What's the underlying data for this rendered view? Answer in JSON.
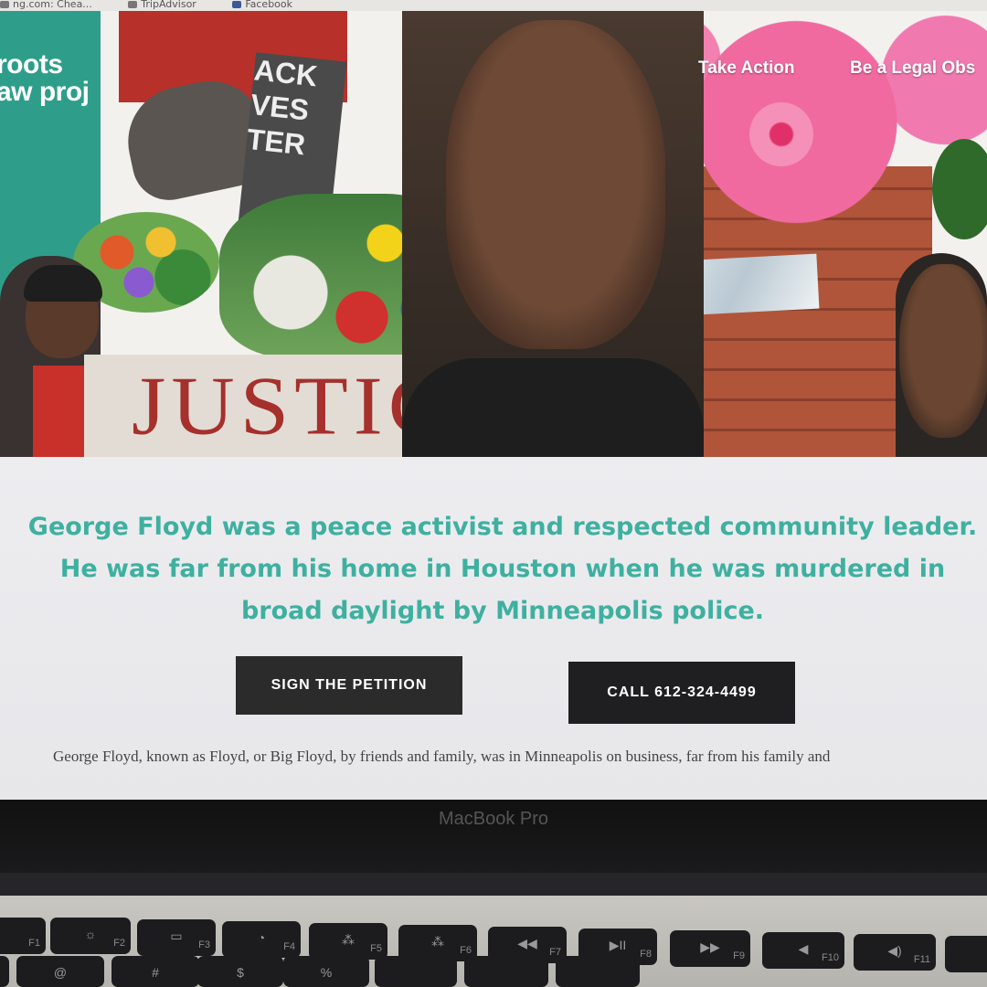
{
  "bookmarks": [
    {
      "label": "ng.com: Chea...",
      "icon": "bookmark-icon"
    },
    {
      "label": "TripAdvisor",
      "icon": "tripadvisor-icon"
    },
    {
      "label": "Facebook",
      "icon": "facebook-icon"
    }
  ],
  "site": {
    "logo_line1": "roots",
    "logo_line2": "aw proj",
    "nav": [
      {
        "label": "Take Action"
      },
      {
        "label": "Be a Legal Obs"
      }
    ]
  },
  "hero": {
    "blm_sign_lines": [
      "ACK",
      "VES",
      "TER"
    ],
    "cardboard_sign": "JUSTICE"
  },
  "content": {
    "mission": "George Floyd was a peace activist and respected community leader. He was far from his home in Houston when he was murdered in broad daylight by Minneapolis police.",
    "petition_button": "SIGN THE PETITION",
    "call_button": "CALL 612-324-4499",
    "bio": "George Floyd, known as Floyd, or Big Floyd, by friends and family, was in Minneapolis on business, far from his family and"
  },
  "laptop": {
    "model": "MacBook Pro",
    "fn_keys": [
      {
        "glyph": "☼",
        "label": "F2"
      },
      {
        "glyph": "▭",
        "label": "F3"
      },
      {
        "glyph": "◔",
        "label": "F4"
      },
      {
        "glyph": "⁂",
        "label": "F5"
      },
      {
        "glyph": "⁂",
        "label": "F6"
      },
      {
        "glyph": "◀◀",
        "label": "F7"
      },
      {
        "glyph": "▶II",
        "label": "F8"
      },
      {
        "glyph": "▶▶",
        "label": "F9"
      },
      {
        "glyph": "◀",
        "label": "F10"
      },
      {
        "glyph": "◀)",
        "label": "F11"
      }
    ],
    "num_keys": [
      "@",
      "#",
      "$",
      "%"
    ]
  }
}
